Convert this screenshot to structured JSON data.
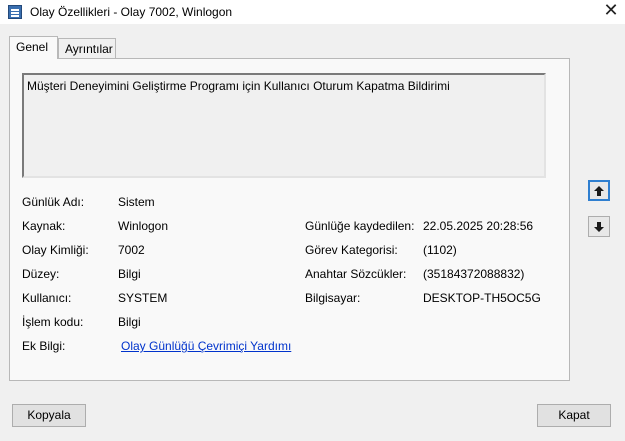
{
  "window": {
    "title": "Olay Özellikleri - Olay 7002, Winlogon",
    "close_glyph": "✕"
  },
  "tabs": [
    {
      "label": "Genel",
      "active": true
    },
    {
      "label": "Ayrıntılar",
      "active": false
    }
  ],
  "general": {
    "description": "Müşteri Deneyimini Geliştirme Programı için Kullanıcı Oturum Kapatma Bildirimi",
    "fields_left": [
      {
        "label": "Günlük Adı:",
        "value": "Sistem"
      },
      {
        "label": "Kaynak:",
        "value": "Winlogon"
      },
      {
        "label": "Olay Kimliği:",
        "value": "7002"
      },
      {
        "label": "Düzey:",
        "value": "Bilgi"
      },
      {
        "label": "Kullanıcı:",
        "value": "SYSTEM"
      },
      {
        "label": "İşlem kodu:",
        "value": "Bilgi"
      },
      {
        "label": "Ek Bilgi:",
        "value": "Olay Günlüğü Çevrimiçi Yardımı"
      }
    ],
    "fields_right": [
      {
        "label": "Günlüğe kaydedilen:",
        "value": "22.05.2025 20:28:56"
      },
      {
        "label": "Görev Kategorisi:",
        "value": "(1102)"
      },
      {
        "label": "Anahtar Sözcükler:",
        "value": "(35184372088832)"
      },
      {
        "label": "Bilgisayar:",
        "value": "DESKTOP-TH5OC5G"
      }
    ]
  },
  "nav": {
    "up_icon": "arrow-up-icon",
    "down_icon": "arrow-down-icon"
  },
  "buttons": {
    "copy": "Kopyala",
    "close": "Kapat"
  }
}
